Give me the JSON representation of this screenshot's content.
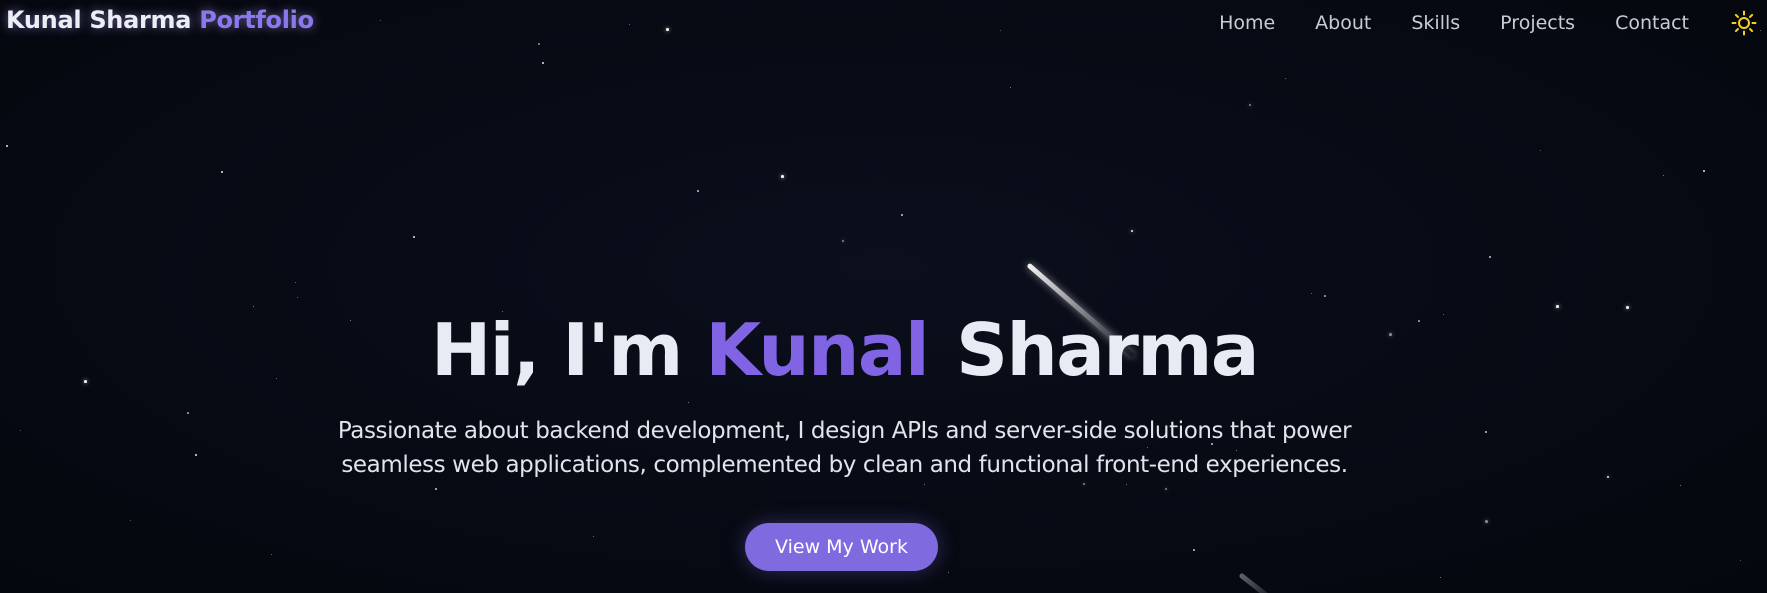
{
  "header": {
    "brand_name": "Kunal Sharma",
    "brand_accent": "Portfolio",
    "nav": [
      {
        "label": "Home"
      },
      {
        "label": "About"
      },
      {
        "label": "Skills"
      },
      {
        "label": "Projects"
      },
      {
        "label": "Contact"
      }
    ],
    "theme_icon": "sun-icon"
  },
  "hero": {
    "greeting": "Hi, I'm",
    "first_name": "Kunal",
    "last_name": "Sharma",
    "subtitle": "Passionate about backend development, I design APIs and server-side solutions that power seamless web applications, complemented by clean and functional front-end experiences.",
    "cta_label": "View My Work"
  },
  "colors": {
    "background": "#070a13",
    "accent": "#7f6ae0",
    "text": "#e9ebf4",
    "sun_icon": "#f6d21c"
  }
}
